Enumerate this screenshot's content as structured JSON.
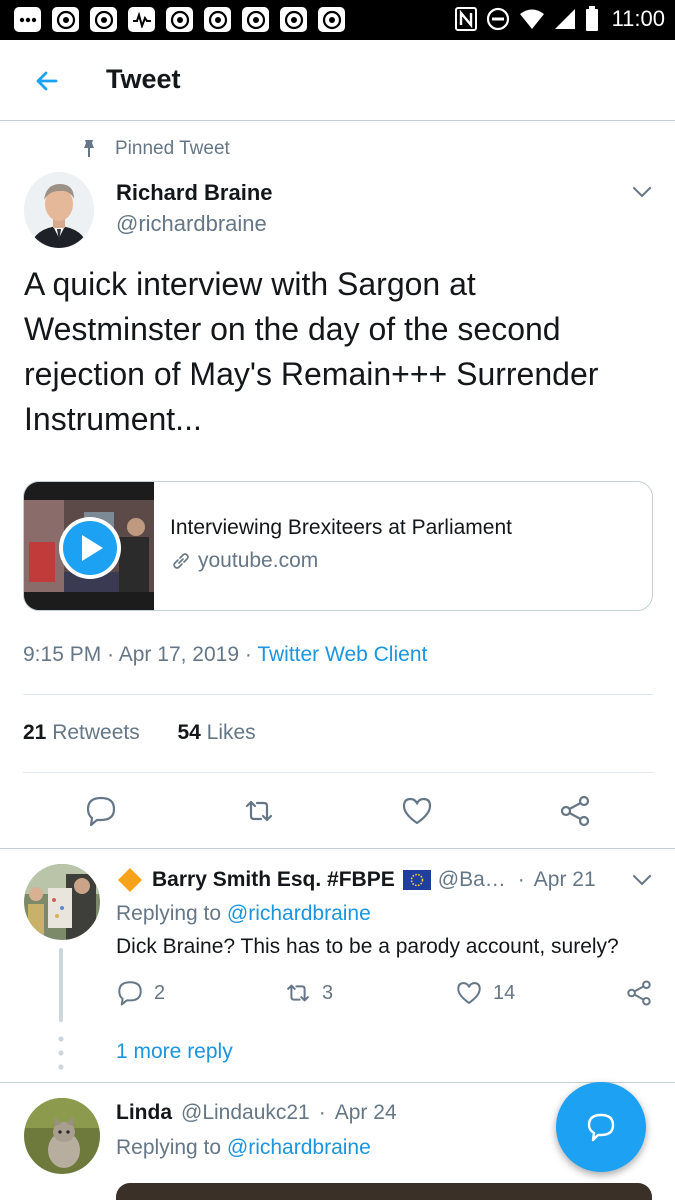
{
  "status_bar": {
    "time": "11:00"
  },
  "header": {
    "title": "Tweet"
  },
  "tweet": {
    "pinned_label": "Pinned Tweet",
    "author_name": "Richard Braine",
    "author_handle": "@richardbraine",
    "text": "A quick interview with Sargon at Westminster on the day of the second rejection of May's Remain+++ Surrender Instrument...",
    "card": {
      "title": "Interviewing Brexiteers at Parliament",
      "domain": "youtube.com"
    },
    "time": "9:15 PM",
    "date": "Apr 17, 2019",
    "separator": "·",
    "client": "Twitter Web Client",
    "retweets_count": "21",
    "retweets_label": "Retweets",
    "likes_count": "54",
    "likes_label": "Likes"
  },
  "replies": [
    {
      "name": "Barry Smith Esq. #FBPE",
      "handle": "@Ba…",
      "date": "Apr 21",
      "replying_to_label": "Replying to",
      "replying_to": "@richardbraine",
      "text": "Dick Braine? This has to be a parody account, surely?",
      "reply_count": "2",
      "retweet_count": "3",
      "like_count": "14",
      "more_replies": "1 more reply"
    },
    {
      "name": "Linda",
      "handle": "@Lindaukc21",
      "date": "Apr 24",
      "replying_to_label": "Replying to",
      "replying_to": "@richardbraine"
    }
  ],
  "icons": {
    "accent": "#1da1f2",
    "link": "#1b95e0",
    "muted": "#657786"
  }
}
